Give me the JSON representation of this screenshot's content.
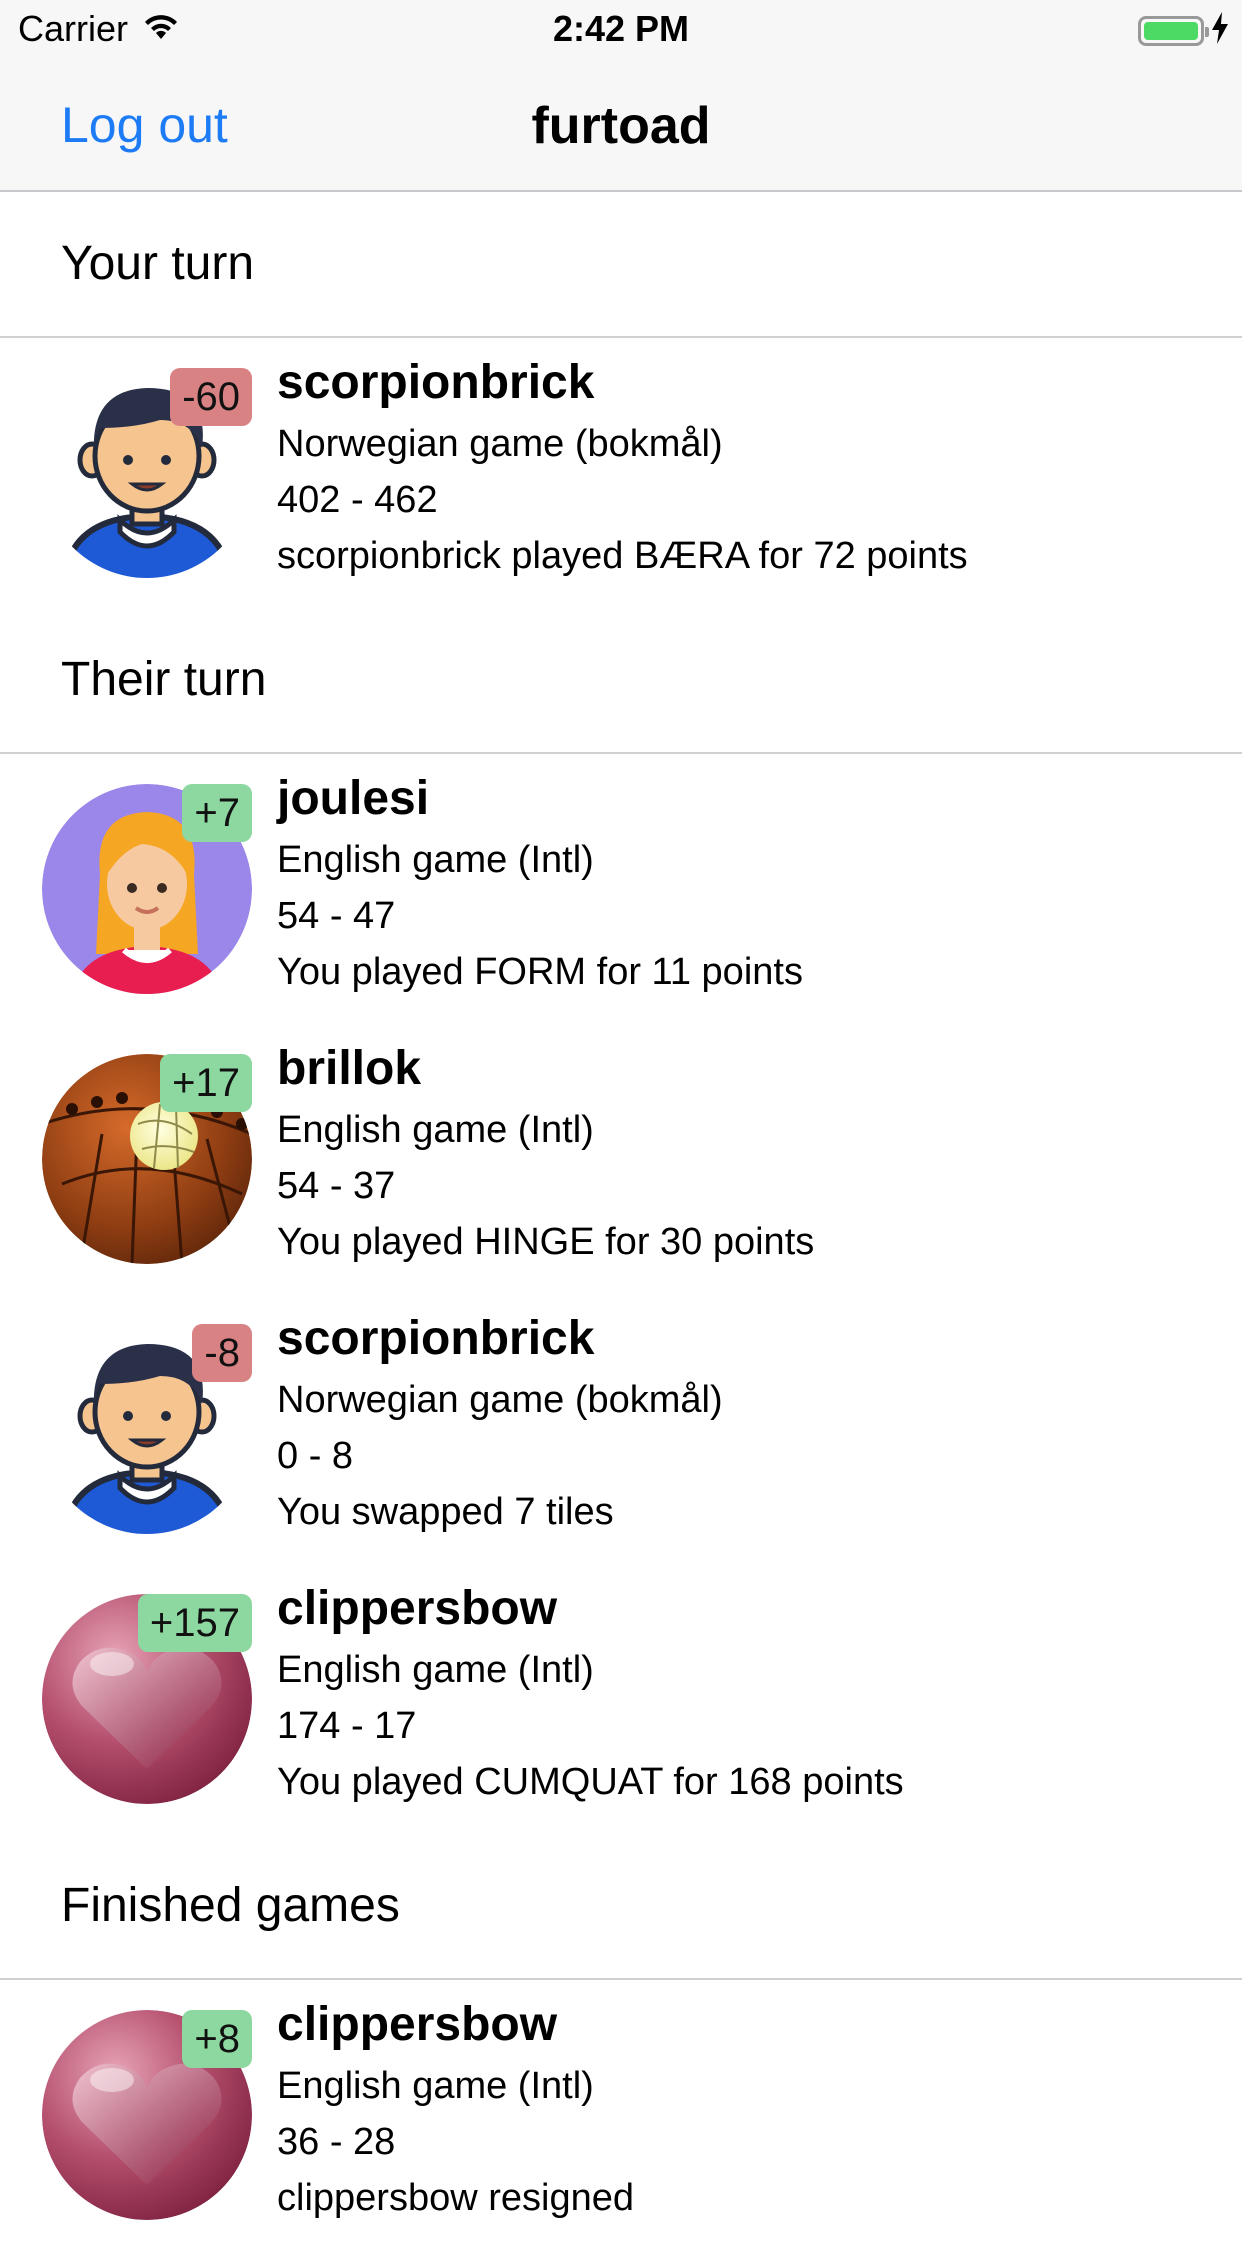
{
  "status_bar": {
    "carrier": "Carrier",
    "time": "2:42 PM",
    "icons": [
      "wifi-icon",
      "battery-icon",
      "charging-icon"
    ]
  },
  "nav": {
    "left_button": "Log out",
    "title": "furtoad"
  },
  "colors": {
    "accent": "#1e7bf6",
    "badge_negative": "#d98283",
    "badge_positive": "#8dd8a0"
  },
  "sections": [
    {
      "title": "Your turn",
      "games": [
        {
          "player": "scorpionbrick",
          "badge": "-60",
          "badge_type": "neg",
          "avatar": "boy-avatar",
          "game": "Norwegian game (bokmål)",
          "score": "402 - 462",
          "last_move": "scorpionbrick played BÆRA for 72 points"
        }
      ]
    },
    {
      "title": "Their turn",
      "games": [
        {
          "player": "joulesi",
          "badge": "+7",
          "badge_type": "pos",
          "avatar": "girl-avatar",
          "game": "English game (Intl)",
          "score": "54 - 47",
          "last_move": "You played FORM for 11 points"
        },
        {
          "player": "brillok",
          "badge": "+17",
          "badge_type": "pos",
          "avatar": "planet-avatar",
          "game": "English game (Intl)",
          "score": "54 - 37",
          "last_move": "You played HINGE for 30 points"
        },
        {
          "player": "scorpionbrick",
          "badge": "-8",
          "badge_type": "neg",
          "avatar": "boy-avatar",
          "game": "Norwegian game (bokmål)",
          "score": "0 - 8",
          "last_move": "You swapped 7 tiles"
        },
        {
          "player": "clippersbow",
          "badge": "+157",
          "badge_type": "pos",
          "avatar": "heart-avatar",
          "game": "English game (Intl)",
          "score": "174 - 17",
          "last_move": "You played CUMQUAT for 168 points"
        }
      ]
    },
    {
      "title": "Finished games",
      "games": [
        {
          "player": "clippersbow",
          "badge": "+8",
          "badge_type": "pos",
          "avatar": "heart-avatar",
          "game": "English game (Intl)",
          "score": "36 - 28",
          "last_move": "clippersbow resigned"
        }
      ]
    }
  ]
}
